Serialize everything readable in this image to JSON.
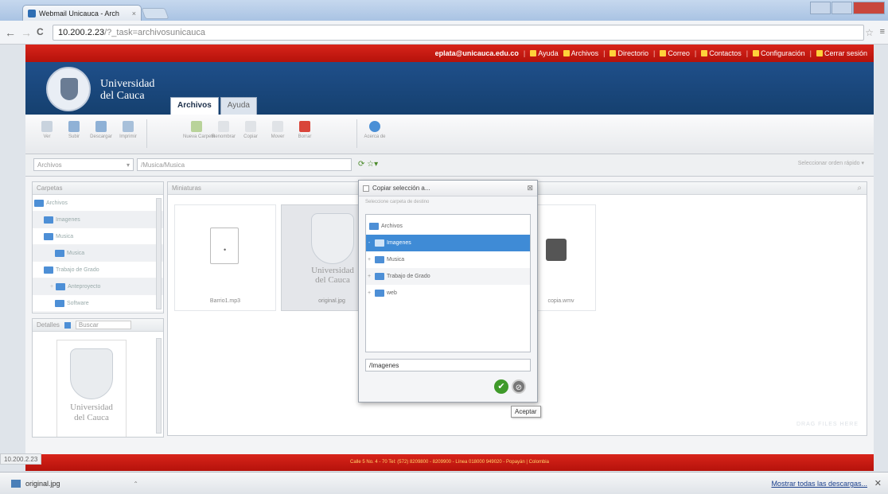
{
  "browser": {
    "tab_title": "Webmail Unicauca - Arch",
    "tab_close": "×",
    "url_host": "10.200.2.23",
    "url_path": "/?_task=archivosunicauca",
    "back": "←",
    "forward": "→",
    "reload": "C",
    "star": "☆",
    "wrench": "🔧"
  },
  "topbar": {
    "user": "eplata@unicauca.edu.co",
    "links": [
      "Ayuda",
      "Archivos",
      "Directorio",
      "Correo",
      "Contactos",
      "Configuración",
      "Cerrar sesión"
    ],
    "separator": "|"
  },
  "brand": {
    "line1": "Universidad",
    "line2": "del Cauca"
  },
  "app_tabs": [
    "Archivos",
    "Ayuda"
  ],
  "toolbar": {
    "buttons": [
      {
        "label": "Ver",
        "color": "#c9d3de"
      },
      {
        "label": "Subir",
        "color": "#8fb1d6"
      },
      {
        "label": "Descargar",
        "color": "#8fb1d6"
      },
      {
        "label": "Imprimir",
        "color": "#a8c0da"
      },
      {
        "label": "Nueva Carpeta",
        "color": "#b9d39a"
      },
      {
        "label": "Renombrar",
        "color": "#e0e3e7"
      },
      {
        "label": "Copiar",
        "color": "#e0e3e7"
      },
      {
        "label": "Mover",
        "color": "#e0e3e7"
      },
      {
        "label": "Borrar",
        "color": "#d9453a"
      },
      {
        "label": "Acerca de",
        "color": "#4a8fd6"
      }
    ]
  },
  "pathbar": {
    "root_select": "Archivos",
    "path": "/Musica/Musica",
    "sort": "Seleccionar orden rápido"
  },
  "folders_panel": {
    "title": "Carpetas",
    "items": [
      {
        "label": "Archivos",
        "indent": 0
      },
      {
        "label": "Imagenes",
        "indent": 1
      },
      {
        "label": "Musica",
        "indent": 1
      },
      {
        "label": "Musica",
        "indent": 2
      },
      {
        "label": "Trabajo de Grado",
        "indent": 1
      },
      {
        "label": "Anteproyecto",
        "indent": 2
      },
      {
        "label": "Software",
        "indent": 2
      }
    ]
  },
  "details_panel": {
    "title": "Detalles",
    "search_placeholder": "Buscar",
    "caption1": "Universidad",
    "caption2": "del Cauca"
  },
  "main": {
    "title": "Miniaturas",
    "files": [
      {
        "name": "Barrio1.mp3"
      },
      {
        "name": "original.jpg"
      },
      {
        "name": "copia.wmv"
      }
    ],
    "crest_caption1": "Universidad",
    "crest_caption2": "del Cauca",
    "watermark": "DRAG FILES HERE"
  },
  "dialog": {
    "title": "Copiar selección a...",
    "hint": "Seleccione carpeta de destino",
    "tree": [
      {
        "label": "Archivos",
        "expander": "",
        "selected": false
      },
      {
        "label": "Imagenes",
        "expander": "-",
        "selected": true
      },
      {
        "label": "Musica",
        "expander": "+",
        "selected": false
      },
      {
        "label": "Trabajo de Grado",
        "expander": "+",
        "selected": false
      },
      {
        "label": "web",
        "expander": "+",
        "selected": false
      }
    ],
    "path_value": "/Imagenes",
    "ok_icon": "✔",
    "cancel_icon": "⊘",
    "tooltip": "Aceptar"
  },
  "footer": {
    "text": "Calle 5 No. 4 - 70 Tel: (572) 8209800 - 8209900 - Línea 018000 949020 - Popayán | Colombia"
  },
  "status": {
    "url": "10.200.2.23"
  },
  "downloads": {
    "file": "original.jpg",
    "arrow": "⌃",
    "show_all": "Mostrar todas las descargas...",
    "close": "✕"
  }
}
